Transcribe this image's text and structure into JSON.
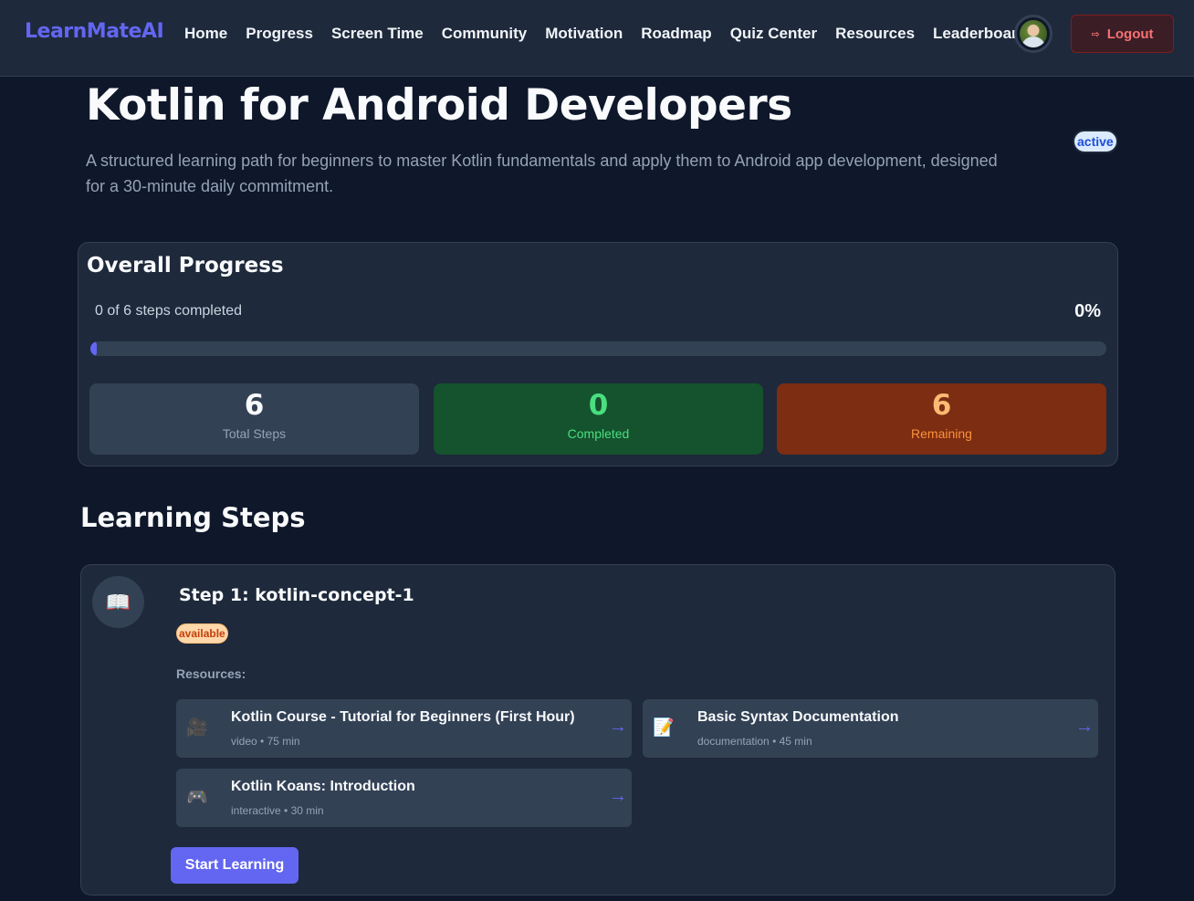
{
  "brand": "LearnMateAI",
  "nav": {
    "links": [
      "Home",
      "Progress",
      "Screen Time",
      "Community",
      "Motivation",
      "Roadmap",
      "Quiz Center",
      "Resources",
      "Leaderboard"
    ],
    "logout_label": "Logout"
  },
  "path": {
    "title": "Kotlin for Android Developers",
    "description": "A structured learning path for beginners to master Kotlin fundamentals and apply them to Android app development, designed for a 30-minute daily commitment.",
    "status": "active"
  },
  "progress": {
    "title": "Overall Progress",
    "steps_text": "0 of 6 steps completed",
    "percent_text": "0%",
    "fraction": 0,
    "stats": {
      "total": {
        "value": "6",
        "label": "Total Steps"
      },
      "completed": {
        "value": "0",
        "label": "Completed"
      },
      "remaining": {
        "value": "6",
        "label": "Remaining"
      }
    }
  },
  "steps_section": {
    "title": "Learning Steps",
    "steps": [
      {
        "title": "Step 1: kotlin-concept-1",
        "status": "available",
        "resources_label": "Resources:",
        "resources": [
          {
            "title": "Kotlin Course - Tutorial for Beginners (First Hour)",
            "type": "video",
            "duration": "75 min",
            "icon": "video-camera-icon"
          },
          {
            "title": "Basic Syntax Documentation",
            "type": "documentation",
            "duration": "45 min",
            "icon": "document-icon"
          },
          {
            "title": "Kotlin Koans: Introduction",
            "type": "interactive",
            "duration": "30 min",
            "icon": "game-controller-icon"
          }
        ],
        "action_label": "Start Learning"
      }
    ]
  },
  "colors": {
    "accent": "#6366f1",
    "background": "#0f172a",
    "surface": "#1e293b"
  }
}
